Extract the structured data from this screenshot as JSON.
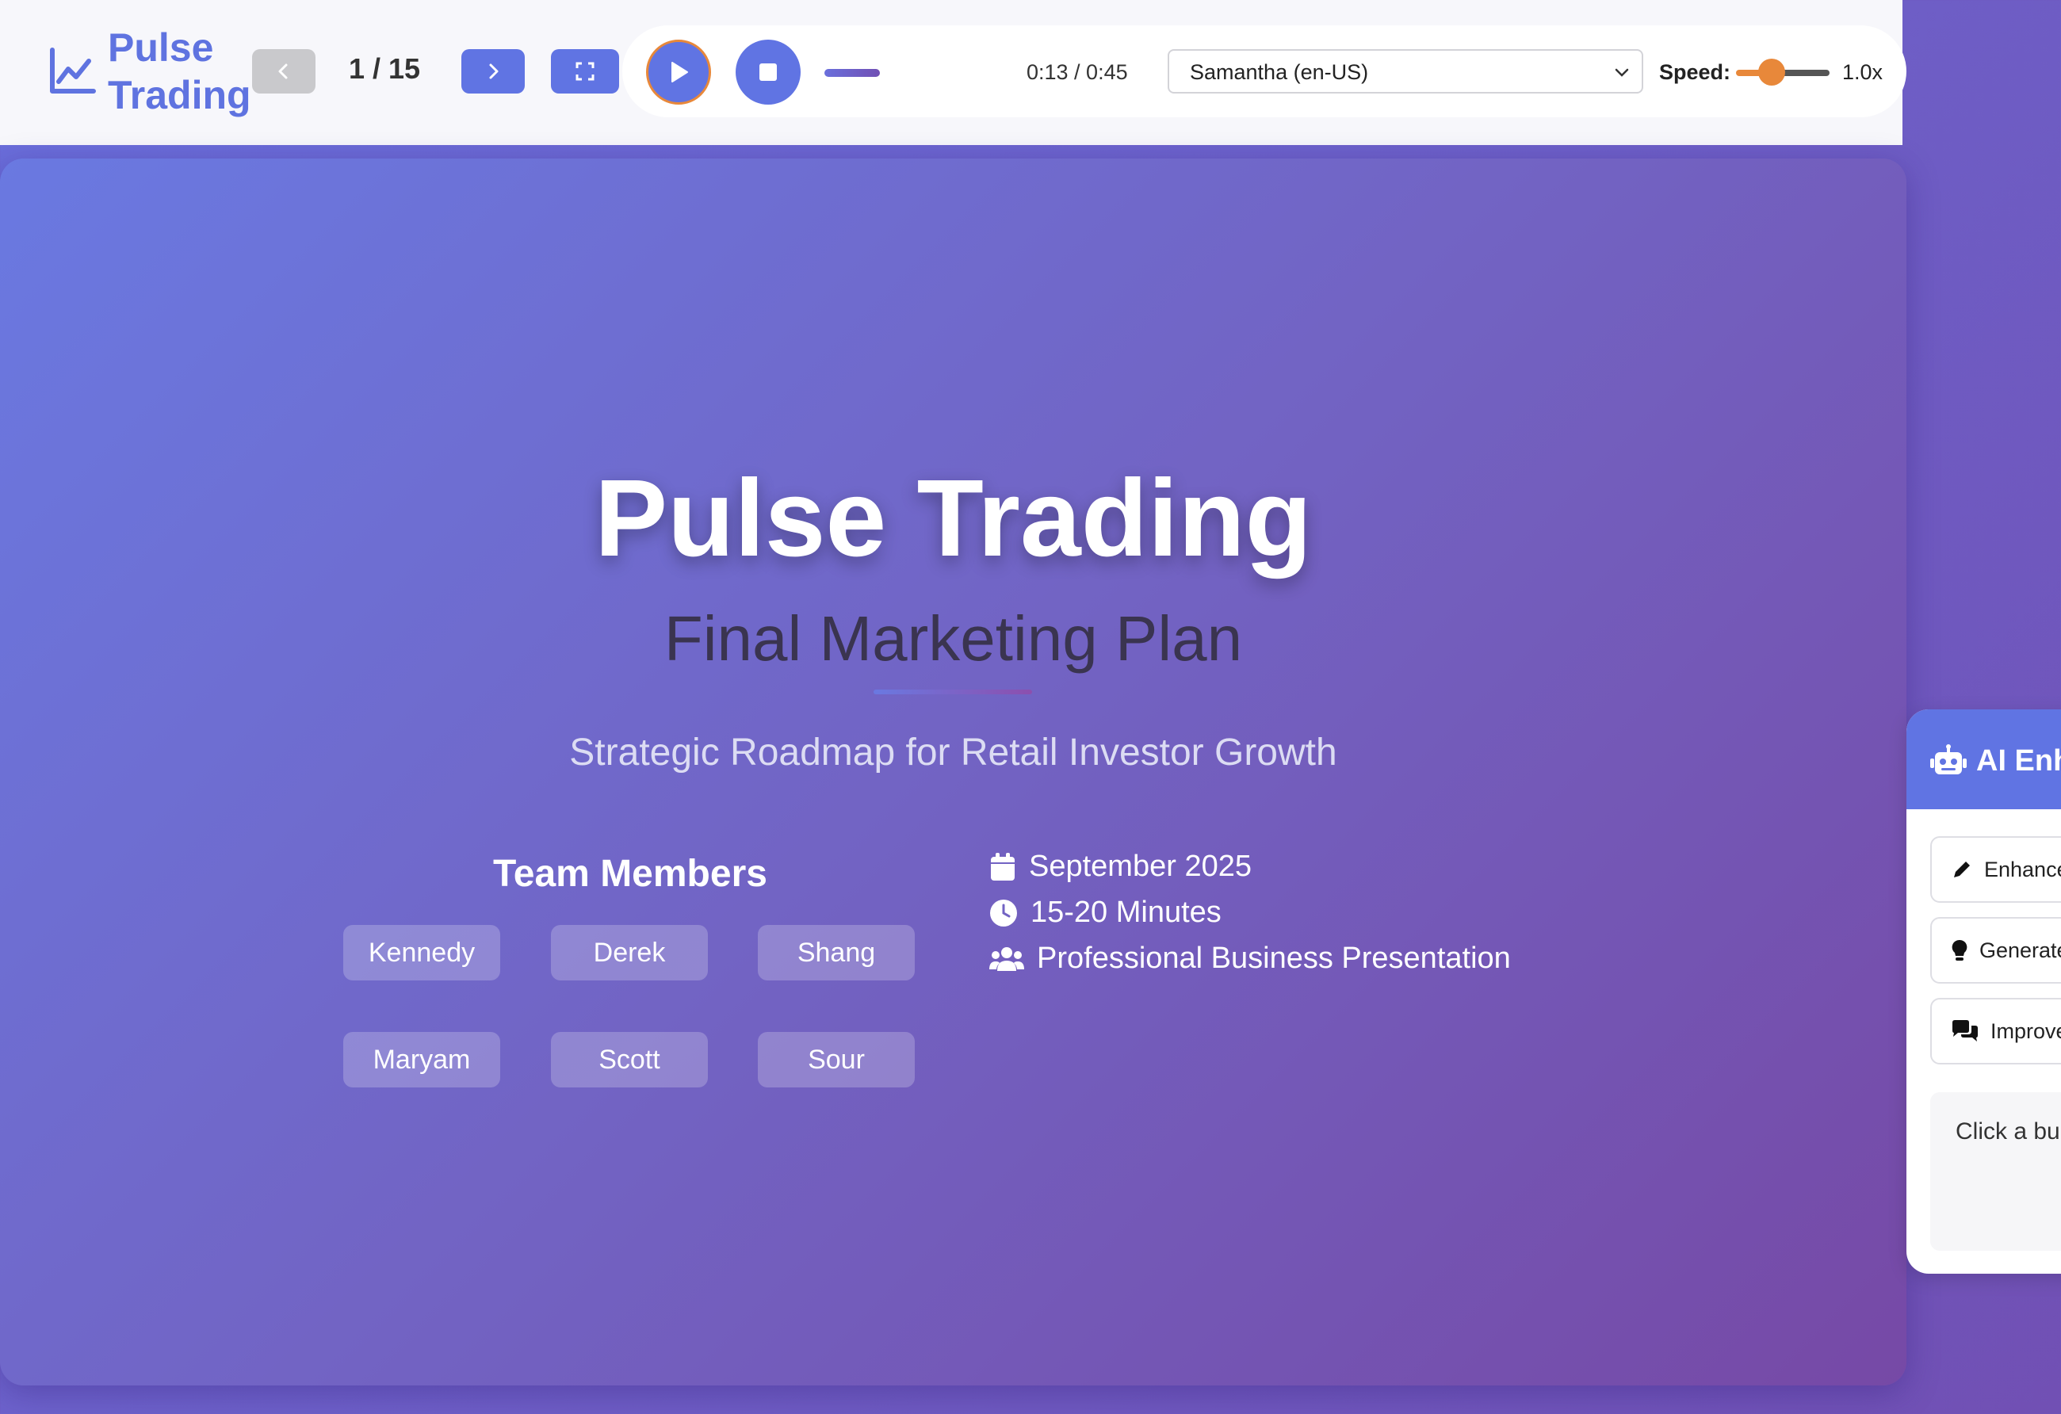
{
  "header": {
    "brand_line1": "Pulse",
    "brand_line2": "Trading",
    "slide_counter": "1 / 15",
    "time": "0:13 / 0:45",
    "voice_selected": "Samantha (en-US)",
    "speed_label": "Speed:",
    "speed_value": "1.0x",
    "speed_level": 0.38,
    "playback_progress": 0.29
  },
  "slide": {
    "title": "Pulse Trading",
    "subtitle": "Final Marketing Plan",
    "tagline": "Strategic Roadmap for Retail Investor Growth",
    "team_heading": "Team Members",
    "members": [
      "Kennedy",
      "Derek",
      "Shang",
      "Maryam",
      "Scott",
      "Sour"
    ],
    "info": [
      {
        "icon": "calendar-icon",
        "text": "September 2025"
      },
      {
        "icon": "clock-icon",
        "text": "15-20 Minutes"
      },
      {
        "icon": "users-icon",
        "text": "Professional Business Presentation"
      }
    ]
  },
  "ai_panel": {
    "title": "AI Enh",
    "buttons": [
      {
        "icon": "pencil-icon",
        "label": "Enhance"
      },
      {
        "icon": "lightbulb-icon",
        "label": "Generate"
      },
      {
        "icon": "comments-icon",
        "label": "Improve"
      }
    ],
    "output_text": "Click a bu your prese"
  },
  "colors": {
    "accent": "#6074e3",
    "orange": "#e8883a",
    "gradient_start": "#6a79e1",
    "gradient_end": "#7649a6"
  }
}
